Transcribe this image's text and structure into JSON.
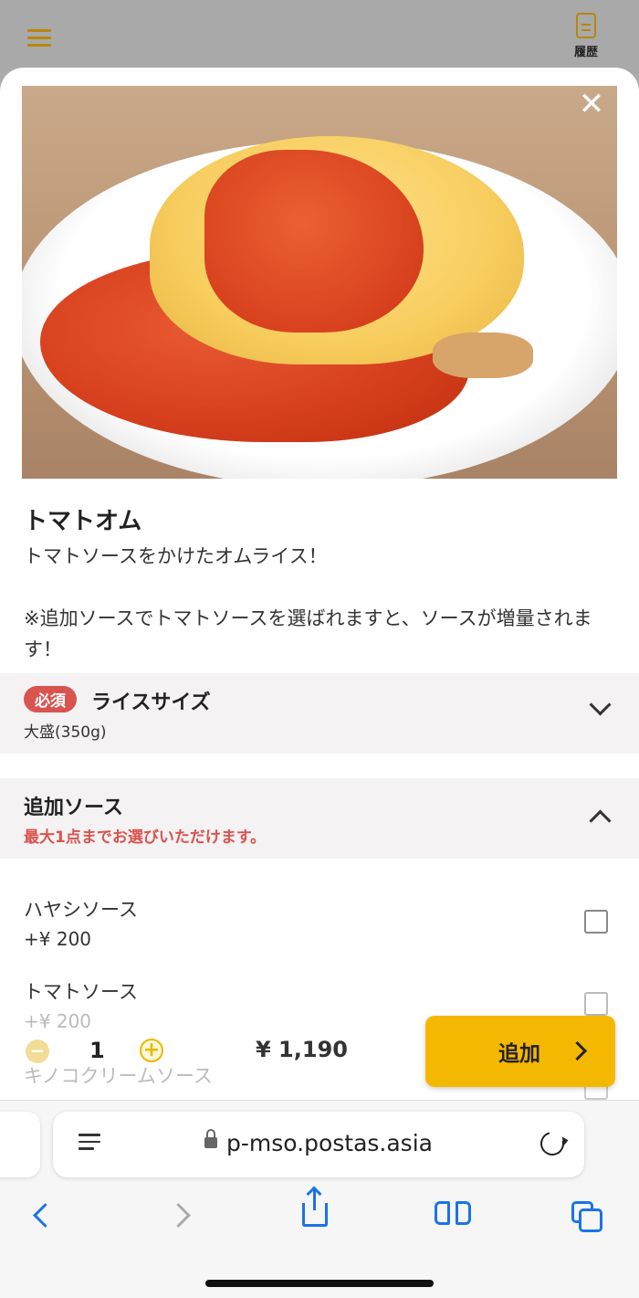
{
  "header": {
    "history_label": "履歴"
  },
  "item": {
    "name": "トマトオム",
    "description": "トマトソースをかけたオムライス！\n\n※追加ソースでトマトソースを選ばれますと、ソースが増量されます！"
  },
  "rice_size": {
    "badge": "必須",
    "title": "ライスサイズ",
    "selected": "大盛(350g)"
  },
  "extra_sauce": {
    "title": "追加ソース",
    "note": "最大1点までお選びいただけます。",
    "options": [
      {
        "name": "ハヤシソース",
        "price": "+¥ 200",
        "checked": false
      },
      {
        "name": "トマトソース",
        "price": "+¥ 200",
        "checked": false
      },
      {
        "name": "キノコクリームソース",
        "price": "",
        "checked": false
      }
    ]
  },
  "order": {
    "quantity": "1",
    "total": "¥ 1,190",
    "add_label": "追加"
  },
  "browser": {
    "url": "p-mso.postas.asia"
  },
  "colors": {
    "accent": "#f5b800",
    "required": "#d9534f",
    "link": "#1a73e8"
  }
}
